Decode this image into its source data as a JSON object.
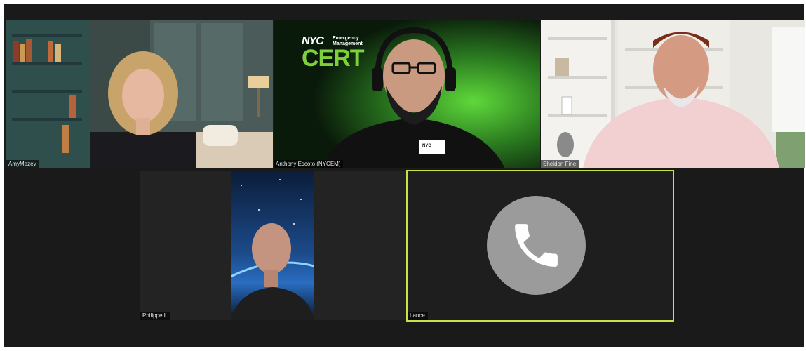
{
  "participants": [
    {
      "name": "AmyMezey"
    },
    {
      "name": "Anthony Escoto (NYCEM)"
    },
    {
      "name": "Sheldon Fine"
    },
    {
      "name": "Philippe L"
    },
    {
      "name": "Lance"
    }
  ],
  "cert_logo": {
    "nyc": "NYC",
    "line1": "Emergency",
    "line2": "Management",
    "cert": "CERT"
  },
  "shirt_logo": {
    "nyc": "NYC",
    "text": "Emergency Management CERT"
  },
  "icons": {
    "phone": "phone-icon"
  },
  "colors": {
    "active_speaker_border": "#c8e24a",
    "background": "#1a1a1a",
    "call_circle": "#9b9b9b",
    "cert_green": "#7fd13b"
  }
}
